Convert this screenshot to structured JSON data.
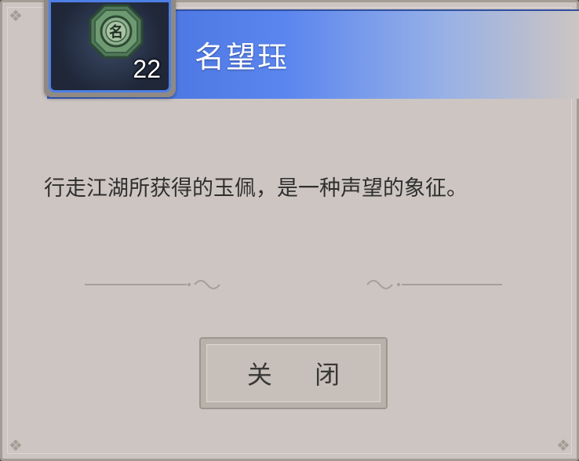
{
  "item": {
    "name": "名望珏",
    "count": "22",
    "icon": "reputation-jade-icon",
    "icon_glyph": "名"
  },
  "description": "行走江湖所获得的玉佩，是一种声望的象征。",
  "buttons": {
    "close_label": "关 闭"
  },
  "colors": {
    "banner_blue": "#3f68d6",
    "panel_bg": "#ccc5c2",
    "frame_border": "#4d7fe6"
  }
}
